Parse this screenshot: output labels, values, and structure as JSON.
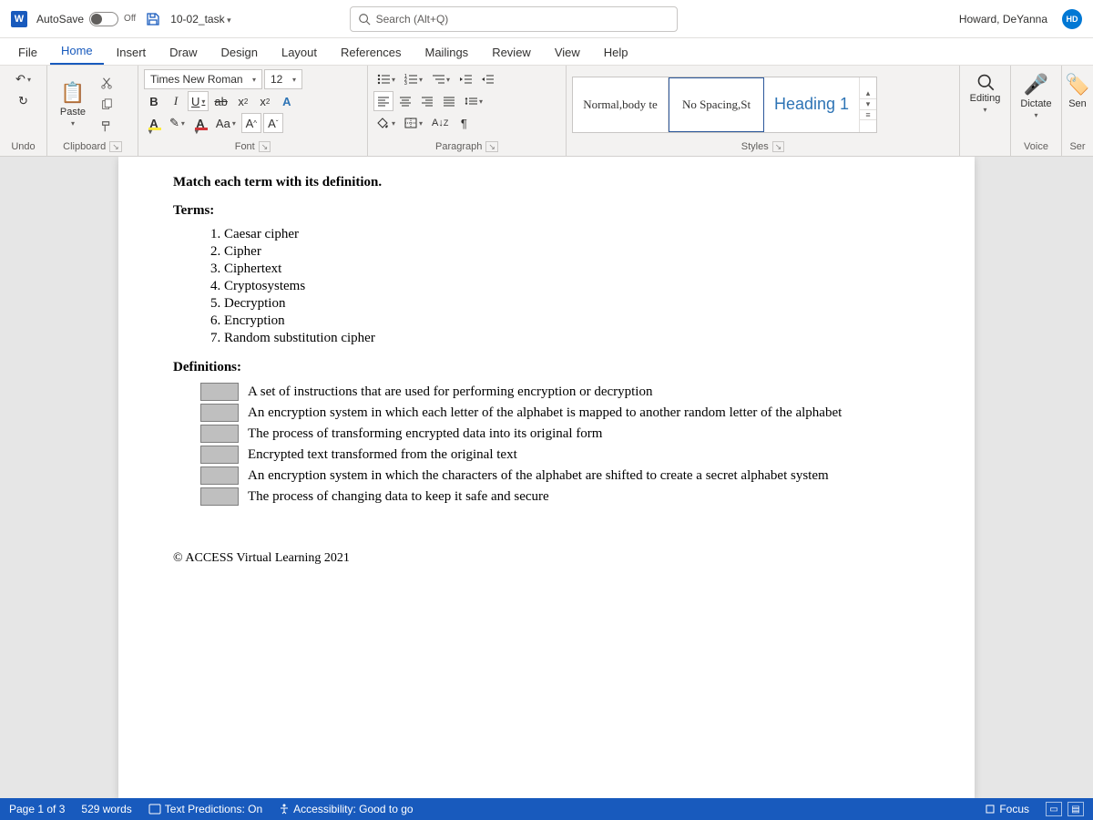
{
  "titlebar": {
    "autosave_label": "AutoSave",
    "autosave_state": "Off",
    "filename": "10-02_task",
    "search_placeholder": "Search (Alt+Q)",
    "username": "Howard, DeYanna",
    "avatar_initials": "HD"
  },
  "tabs": [
    "File",
    "Home",
    "Insert",
    "Draw",
    "Design",
    "Layout",
    "References",
    "Mailings",
    "Review",
    "View",
    "Help"
  ],
  "active_tab": "Home",
  "ribbon": {
    "undo_label": "Undo",
    "clipboard_label": "Clipboard",
    "paste_label": "Paste",
    "font_label": "Font",
    "font_name": "Times New Roman",
    "font_size": "12",
    "paragraph_label": "Paragraph",
    "styles_label": "Styles",
    "styles": [
      {
        "preview": "Normal,body te",
        "name": "Normal"
      },
      {
        "preview": "No Spacing,St",
        "name": "No Spacing"
      },
      {
        "preview": "Heading 1",
        "name": "Heading 1"
      }
    ],
    "editing_label": "Editing",
    "dictate_label": "Dictate",
    "voice_label": "Voice",
    "sensitivity_label": "Sen"
  },
  "document": {
    "instruction": "Match each term with its definition.",
    "terms_heading": "Terms:",
    "terms": [
      "Caesar cipher",
      "Cipher",
      "Ciphertext",
      "Cryptosystems",
      "Decryption",
      "Encryption",
      "Random substitution cipher"
    ],
    "defs_heading": "Definitions:",
    "definitions": [
      "A set of instructions that are used for performing encryption or decryption",
      "An encryption system in which each letter of the alphabet is mapped to another random letter of the alphabet",
      "The process of transforming encrypted data into its original form",
      "Encrypted text transformed from the original text",
      "An encryption system in which the characters of the alphabet are shifted to create a secret alphabet system",
      "The process of changing data to keep it safe and secure"
    ],
    "copyright": "© ACCESS Virtual Learning 2021"
  },
  "statusbar": {
    "page": "Page 1 of 3",
    "words": "529 words",
    "predictions": "Text Predictions: On",
    "accessibility": "Accessibility: Good to go",
    "focus": "Focus"
  }
}
